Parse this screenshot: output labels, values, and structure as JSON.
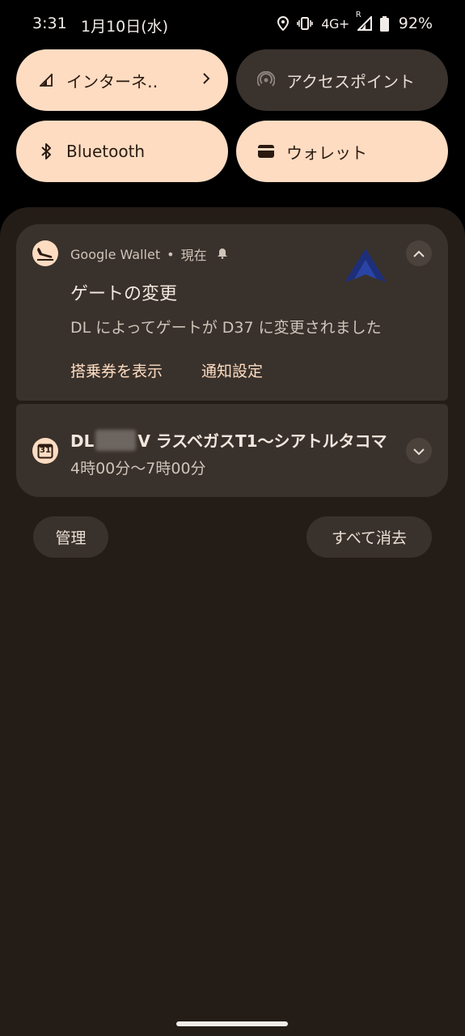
{
  "status_bar": {
    "time": "3:31",
    "date": "1月10日(水)",
    "network": "4G+",
    "roaming": "R",
    "battery": "92%",
    "icons": [
      "location-icon",
      "vibrate-icon",
      "signal-icon",
      "battery-icon"
    ]
  },
  "quick_tiles": [
    {
      "label": "インターネ‥",
      "icon": "signal-icon",
      "state": "on",
      "has_chevron": true
    },
    {
      "label": "アクセスポイント",
      "icon": "hotspot-icon",
      "state": "off"
    },
    {
      "label": "Bluetooth",
      "icon": "bluetooth-icon",
      "state": "on"
    },
    {
      "label": "ウォレット",
      "icon": "wallet-icon",
      "state": "on"
    }
  ],
  "notifications": [
    {
      "app": "Google Wallet",
      "separator": "•",
      "time": "現在",
      "icon": "airplane-landing-icon",
      "alert_icon": "bell-icon",
      "title": "ゲートの変更",
      "text": "DL によってゲートが D37 に変更されました",
      "actions": [
        "搭乗券を表示",
        "通知設定"
      ],
      "expand_icon": "chevron-up-icon"
    },
    {
      "icon": "calendar-icon",
      "calendar_day": "31",
      "title_prefix": "DL",
      "title_suffix": "V ラスベガスT1〜シアトルタコマ",
      "subtitle": "4時00分〜7時00分",
      "expand_icon": "chevron-down-icon"
    }
  ],
  "buttons": {
    "manage": "管理",
    "clear_all": "すべて消去"
  },
  "colors": {
    "tile_on": "#fddcc2",
    "tile_off": "#3a322d",
    "shade": "#241c17",
    "card": "#39312b",
    "delta_blue": "#1e2f7a"
  }
}
